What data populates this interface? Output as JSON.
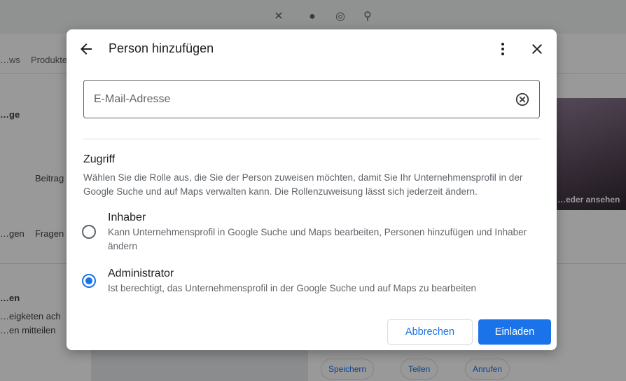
{
  "dialog": {
    "title": "Person hinzufügen",
    "email": {
      "value": "",
      "placeholder": "E-Mail-Adresse"
    },
    "access": {
      "title": "Zugriff",
      "description": "Wählen Sie die Rolle aus, die Sie der Person zuweisen möchten, damit Sie Ihr Unternehmensprofil in der Google Suche und auf Maps verwalten kann. Die Rollenzuweisung lässt sich jederzeit ändern."
    },
    "roles": [
      {
        "label": "Inhaber",
        "description": "Kann Unternehmensprofil in Google Suche und Maps bearbeiten, Personen hinzufügen und Inhaber ändern",
        "selected": false
      },
      {
        "label": "Administrator",
        "description": "Ist berechtigt, das Unternehmensprofil in der Google Suche und auf Maps zu bearbeiten",
        "selected": true
      }
    ],
    "buttons": {
      "cancel": "Abbrechen",
      "invite": "Einladen"
    }
  },
  "background": {
    "nav": [
      "…ws",
      "Produkte"
    ],
    "items": [
      "…ge",
      "Beitrag",
      "…gen",
      "Fragen",
      "…en",
      "…eigketen ach",
      "…en mitteilen"
    ],
    "photo_label": "…eder ansehen",
    "chips": [
      "Speichern",
      "Teilen",
      "Anrufen"
    ]
  },
  "colors": {
    "accent": "#1a73e8",
    "text_primary": "#202124",
    "text_secondary": "#5f6368",
    "border": "#dadce0"
  }
}
